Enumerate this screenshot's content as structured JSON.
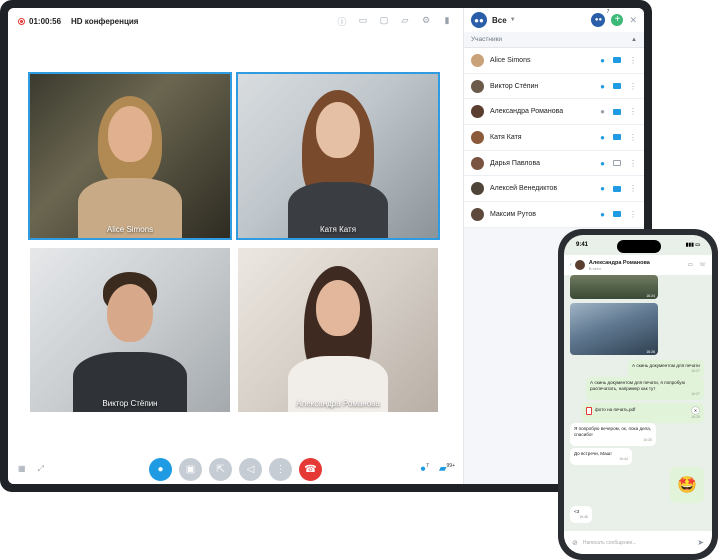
{
  "conference": {
    "timer": "01:00:56",
    "title": "HD конференция",
    "top_icons": [
      "info-icon",
      "folder-icon",
      "screen-icon",
      "chat-icon",
      "settings-icon",
      "stats-icon"
    ],
    "tiles": [
      {
        "name": "Alice Simons",
        "selected": true
      },
      {
        "name": "Катя Катя",
        "selected": true
      },
      {
        "name": "Виктор Стёпин",
        "selected": false
      },
      {
        "name": "Александра Романова",
        "selected": false
      }
    ],
    "participants_count_badge": "7",
    "chat_count_badge": "99+"
  },
  "panel": {
    "title": "Все",
    "group_badge": "7",
    "section_label": "Участники",
    "participants": [
      {
        "name": "Alice Simons",
        "mic": true,
        "cam": true
      },
      {
        "name": "Виктор Стёпин",
        "mic": true,
        "cam": true
      },
      {
        "name": "Александра Романова",
        "mic": false,
        "cam": true
      },
      {
        "name": "Катя Катя",
        "mic": true,
        "cam": true
      },
      {
        "name": "Дарья Павлова",
        "mic": true,
        "cam": false
      },
      {
        "name": "Алексей Венедиктов",
        "mic": true,
        "cam": true
      },
      {
        "name": "Максим Рутов",
        "mic": true,
        "cam": true
      }
    ]
  },
  "phone": {
    "time": "9:41",
    "contact_name": "Александра Романова",
    "contact_status": "В сети",
    "messages": [
      {
        "text": "А скинь документом для печати",
        "time": "16:27"
      },
      {
        "text": "А скинь документом для печати, я попробую распечатать, например как тут",
        "time": "16:27"
      },
      {
        "file": "фото на печать.pdf",
        "time": "16:29"
      },
      {
        "text": "Я попробую вечером, ок, пока дела, спасибо!",
        "time": "16:30"
      },
      {
        "text": "До встречи, Маш!",
        "time": "16:44"
      },
      {
        "text": "<3",
        "time": "16:48"
      }
    ],
    "emoji": "🤩",
    "image_time_1": "16:24",
    "image_time_2": "16:26",
    "input_placeholder": "Написать сообщение..."
  }
}
